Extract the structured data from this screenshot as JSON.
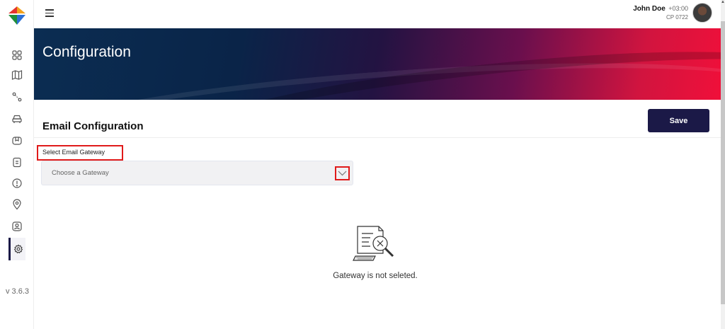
{
  "sidebar": {
    "items": [
      {
        "icon": "dashboard-grid-icon"
      },
      {
        "icon": "map-icon"
      },
      {
        "icon": "route-icon"
      },
      {
        "icon": "car-icon"
      },
      {
        "icon": "package-icon"
      },
      {
        "icon": "clipboard-icon"
      },
      {
        "icon": "alert-icon"
      },
      {
        "icon": "location-pin-icon"
      },
      {
        "icon": "user-badge-icon"
      },
      {
        "icon": "settings-gear-icon",
        "active": true
      }
    ],
    "version": "v 3.6.3"
  },
  "topbar": {
    "user_name": "John Doe",
    "timezone": "+03:00",
    "user_code": "CP 0722"
  },
  "banner": {
    "title": "Configuration"
  },
  "main": {
    "section_title": "Email Configuration",
    "save_label": "Save",
    "gateway_label": "Select Email Gateway",
    "gateway_placeholder": "Choose a Gateway",
    "empty_message": "Gateway is not seleted."
  },
  "colors": {
    "primary": "#1b1947",
    "highlight": "#e01a1a"
  }
}
